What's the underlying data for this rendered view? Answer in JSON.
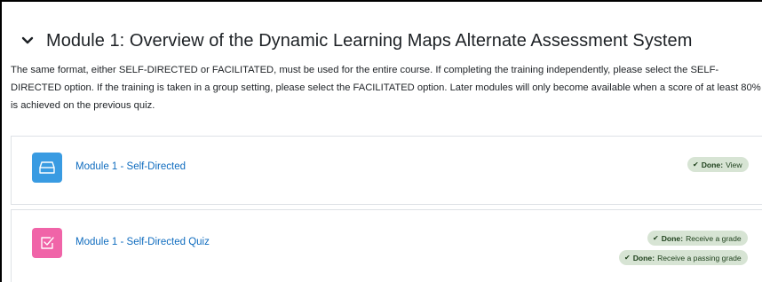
{
  "section": {
    "title": "Module 1: Overview of the Dynamic Learning Maps Alternate Assessment System",
    "summary": "The same format, either SELF-DIRECTED or FACILITATED, must be used for the entire course. If completing the training independently, please select the SELF-DIRECTED option. If the training is taken in a group setting, please select the FACILITATED option. Later modules will only become available when a score of at least 80% is achieved on the previous quiz."
  },
  "activities": [
    {
      "name": "Module 1 - Self-Directed",
      "icon": "page-icon",
      "icon_color": "#399be2",
      "completion": [
        {
          "label": "Done:",
          "text": "View"
        }
      ]
    },
    {
      "name": "Module 1 - Self-Directed Quiz",
      "icon": "quiz-icon",
      "icon_color": "#f064a8",
      "completion": [
        {
          "label": "Done:",
          "text": "Receive a grade"
        },
        {
          "label": "Done:",
          "text": "Receive a passing grade"
        }
      ]
    }
  ],
  "colors": {
    "link": "#0f6cbf",
    "badge_bg": "#d7e4d4",
    "badge_text": "#1c3f1a",
    "divider": "#dee2e6"
  }
}
